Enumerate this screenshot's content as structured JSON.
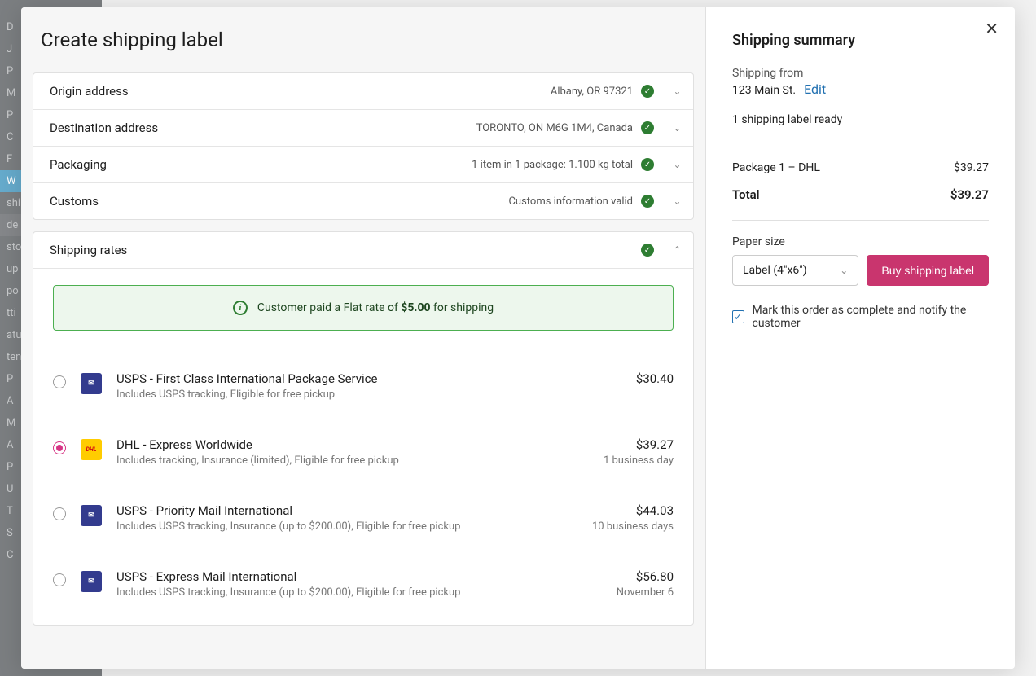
{
  "modal": {
    "title": "Create shipping label",
    "sections": {
      "origin": {
        "label": "Origin address",
        "value": "Albany, OR  97321"
      },
      "destination": {
        "label": "Destination address",
        "value": "TORONTO, ON  M6G 1M4, Canada"
      },
      "packaging": {
        "label": "Packaging",
        "value": "1 item in 1 package: 1.100 kg total"
      },
      "customs": {
        "label": "Customs",
        "value": "Customs information valid"
      },
      "rates": {
        "label": "Shipping rates"
      }
    },
    "banner": {
      "prefix": "Customer paid a Flat rate of ",
      "amount": "$5.00",
      "suffix": " for shipping"
    },
    "rate_options": [
      {
        "carrier": "usps",
        "name": "USPS - First Class International Package Service",
        "desc": "Includes USPS tracking, Eligible for free pickup",
        "price": "$30.40",
        "eta": "",
        "selected": false
      },
      {
        "carrier": "dhl",
        "name": "DHL - Express Worldwide",
        "desc": "Includes tracking, Insurance (limited), Eligible for free pickup",
        "price": "$39.27",
        "eta": "1 business day",
        "selected": true
      },
      {
        "carrier": "usps",
        "name": "USPS - Priority Mail International",
        "desc": "Includes USPS tracking, Insurance (up to $200.00), Eligible for free pickup",
        "price": "$44.03",
        "eta": "10 business days",
        "selected": false
      },
      {
        "carrier": "usps",
        "name": "USPS - Express Mail International",
        "desc": "Includes USPS tracking, Insurance (up to $200.00), Eligible for free pickup",
        "price": "$56.80",
        "eta": "November 6",
        "selected": false
      }
    ]
  },
  "summary": {
    "title": "Shipping summary",
    "from_label": "Shipping from",
    "from_addr": "123 Main St.",
    "edit": "Edit",
    "ready": "1 shipping label ready",
    "package_line_label": "Package 1 – DHL",
    "package_line_price": "$39.27",
    "total_label": "Total",
    "total_price": "$39.27",
    "paper_size_label": "Paper size",
    "paper_size_value": "Label (4\"x6\")",
    "buy_label": "Buy shipping label",
    "checkbox_label": "Mark this order as complete and notify the customer"
  }
}
